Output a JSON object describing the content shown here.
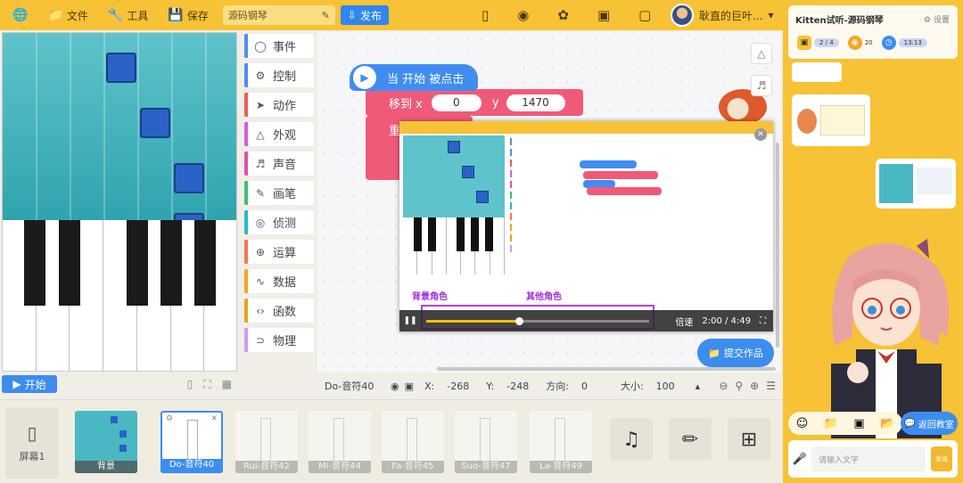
{
  "topbar": {
    "file": "文件",
    "tools": "工具",
    "save": "保存",
    "project_name": "源码钢琴",
    "publish": "发布",
    "username": "耿直的巨叶..."
  },
  "stage": {
    "start": "开始"
  },
  "categories": [
    {
      "label": "事件",
      "color": "#4c8df0"
    },
    {
      "label": "控制",
      "color": "#4c8df0"
    },
    {
      "label": "动作",
      "color": "#f05a5a"
    },
    {
      "label": "外观",
      "color": "#d25ee0"
    },
    {
      "label": "声音",
      "color": "#e050a8"
    },
    {
      "label": "画笔",
      "color": "#3cc078"
    },
    {
      "label": "侦测",
      "color": "#27b8c8"
    },
    {
      "label": "运算",
      "color": "#f07850"
    },
    {
      "label": "数据",
      "color": "#f5a623"
    },
    {
      "label": "函数",
      "color": "#e8a020"
    },
    {
      "label": "物理",
      "color": "#c89cf5"
    }
  ],
  "blocks": {
    "hat": "当 开始 被点击",
    "move": "移到 x",
    "x": "0",
    "y_label": "y",
    "y": "1470",
    "partial": "重"
  },
  "video": {
    "bg_label": "背景角色",
    "other_label": "其他角色",
    "speed": "倍速",
    "time": "2:00 / 4:49"
  },
  "submit": "提交作品",
  "info": {
    "sprite": "Do-音符40",
    "x_label": "X:",
    "x": "-268",
    "y_label": "Y:",
    "y": "-248",
    "dir_label": "方向:",
    "dir": "0",
    "size_label": "大小:",
    "size": "100"
  },
  "sprites": {
    "screen": "屏幕1",
    "items": [
      "背景",
      "Do-音符40",
      "Rui-音符42",
      "Mi-音符44",
      "Fa-音符45",
      "Suo-音符47",
      "La-音符49"
    ]
  },
  "panel": {
    "title": "Kitten试听-源码钢琴",
    "settings": "设置",
    "stat1": "2 / 4",
    "stat2": "20",
    "stat3": "13:13",
    "back": "返回教室",
    "input_placeholder": "请输入文字",
    "send": "发送"
  }
}
